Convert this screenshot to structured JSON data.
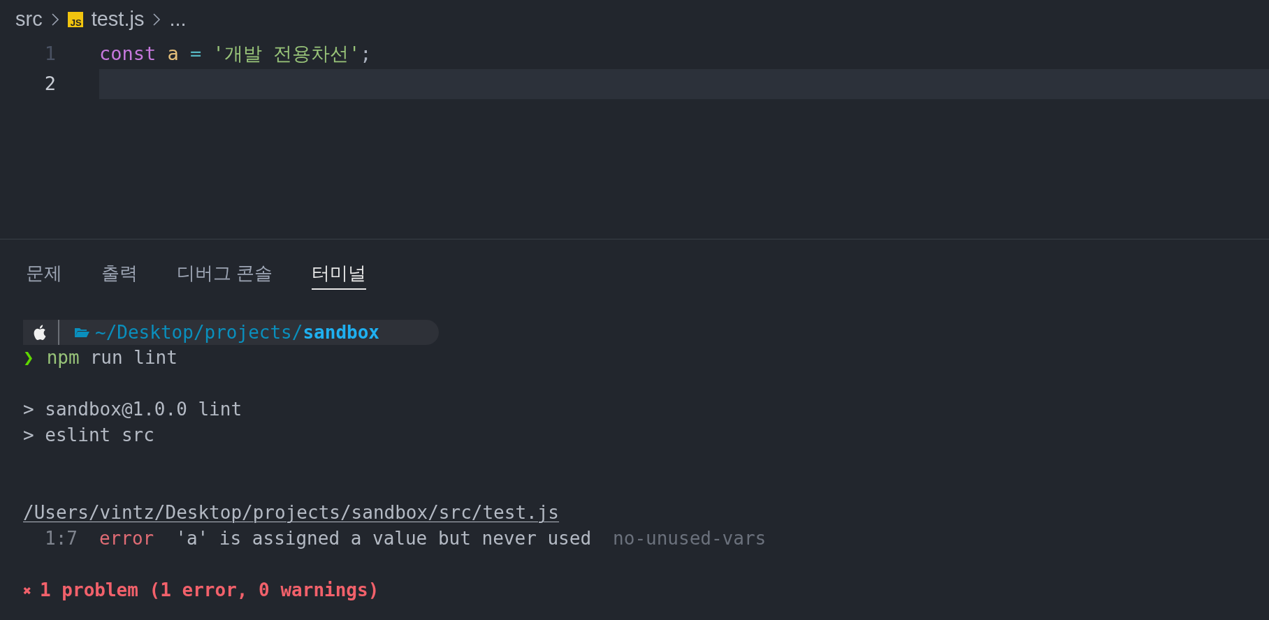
{
  "breadcrumb": [
    {
      "kind": "folder",
      "text": "src"
    },
    {
      "kind": "file",
      "icon_label": "JS",
      "text": "test.js"
    },
    {
      "kind": "more",
      "text": "..."
    }
  ],
  "editor": {
    "lines": [
      {
        "number": "1",
        "current": false,
        "tokens": [
          {
            "kind": "keyword",
            "text": "const "
          },
          {
            "kind": "variable",
            "text": "a "
          },
          {
            "kind": "operator",
            "text": "= "
          },
          {
            "kind": "string",
            "text": "'개발 전용차선'"
          },
          {
            "kind": "punctuation",
            "text": ";"
          }
        ]
      },
      {
        "number": "2",
        "current": true
      }
    ]
  },
  "panel_tabs": [
    {
      "label": "문제",
      "selected": false
    },
    {
      "label": "출력",
      "selected": false
    },
    {
      "label": "디버그 콘솔",
      "selected": false
    },
    {
      "label": "터미널",
      "selected": true
    }
  ],
  "terminal": {
    "prompt": {
      "path": "~/Desktop/projects/",
      "dir": "sandbox"
    },
    "lines": [
      {
        "kind": "command",
        "symbol": "❯",
        "program": "npm",
        "args": "run lint"
      },
      {
        "kind": "blank"
      },
      {
        "kind": "output",
        "text": "> sandbox@1.0.0 lint"
      },
      {
        "kind": "output",
        "text": "> eslint src"
      },
      {
        "kind": "blank"
      },
      {
        "kind": "blank"
      },
      {
        "kind": "file",
        "text": "/Users/vintz/Desktop/projects/sandbox/src/test.js"
      },
      {
        "kind": "problem",
        "position": "1:7",
        "severity": "error",
        "message": "'a' is assigned a value but never used",
        "rule": "no-unused-vars"
      },
      {
        "kind": "blank"
      },
      {
        "kind": "summary",
        "symbol": "✖",
        "text": "1 problem (1 error, 0 warnings)"
      }
    ]
  }
}
